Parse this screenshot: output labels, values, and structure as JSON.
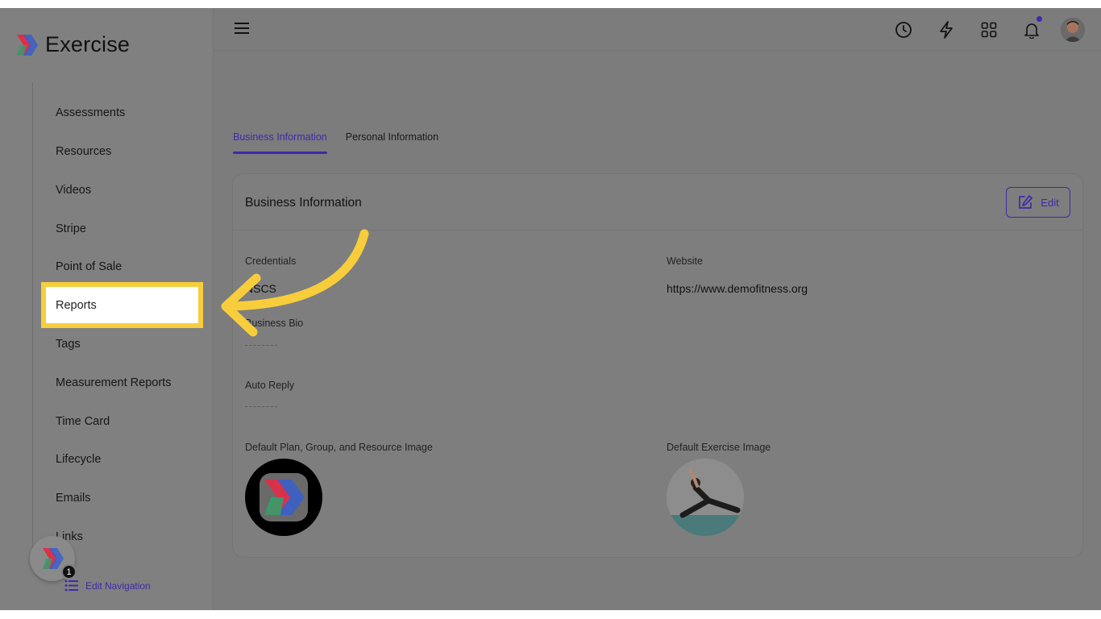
{
  "app": {
    "name": "Exercise"
  },
  "sidebar": {
    "items": [
      {
        "label": "Assessments"
      },
      {
        "label": "Resources"
      },
      {
        "label": "Videos"
      },
      {
        "label": "Stripe"
      },
      {
        "label": "Point of Sale"
      },
      {
        "label": "Reports"
      },
      {
        "label": "Tags"
      },
      {
        "label": "Measurement Reports"
      },
      {
        "label": "Time Card"
      },
      {
        "label": "Lifecycle"
      },
      {
        "label": "Emails"
      },
      {
        "label": "Links"
      }
    ],
    "fab_badge": "1",
    "edit_nav_label": "Edit Navigation"
  },
  "topbar": {
    "icons": [
      "clock-icon",
      "lightning-icon",
      "grid-icon",
      "bell-icon"
    ]
  },
  "tabs": [
    {
      "label": "Business Information",
      "active": true
    },
    {
      "label": "Personal Information",
      "active": false
    }
  ],
  "card": {
    "title": "Business Information",
    "edit_label": "Edit",
    "credentials_label": "Credentials",
    "credentials_value": "NSCS",
    "website_label": "Website",
    "website_value": "https://www.demofitness.org",
    "bio_label": "Business Bio",
    "auto_reply_label": "Auto Reply",
    "plan_image_label": "Default Plan, Group, and Resource Image",
    "exercise_image_label": "Default Exercise Image"
  },
  "colors": {
    "accent": "#3f2aa8",
    "highlight": "#f8cd3c"
  }
}
